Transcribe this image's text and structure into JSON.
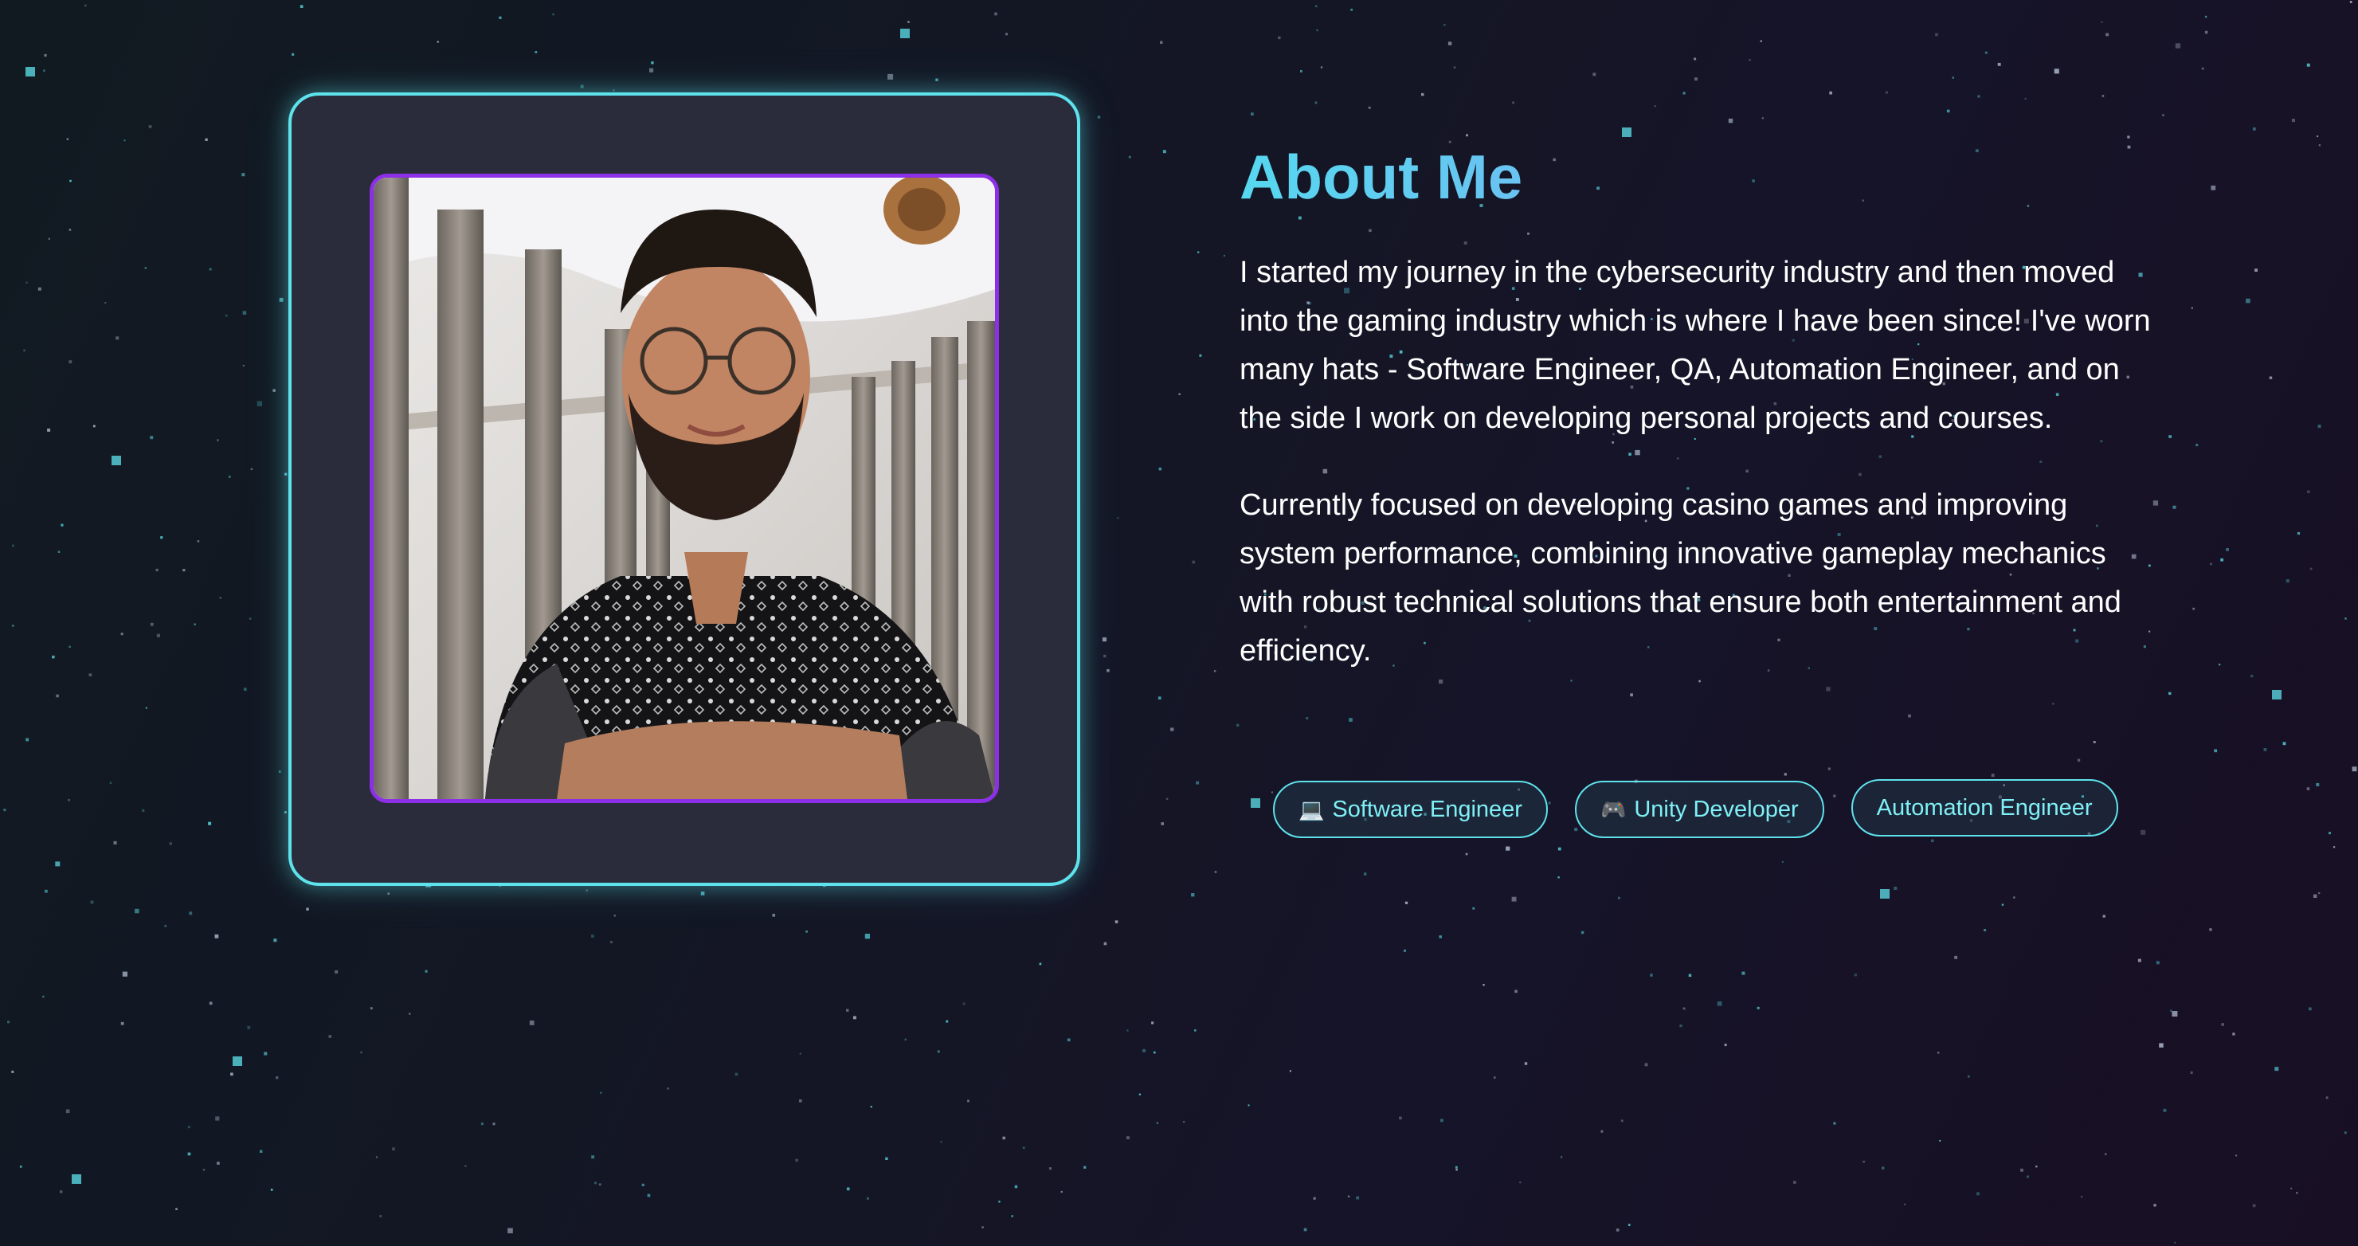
{
  "about": {
    "heading": "About Me",
    "paragraphs": [
      "I started my journey in the cybersecurity industry and then moved into the gaming industry which is where I have been since! I've worn many hats - Software Engineer, QA, Automation Engineer, and on the side I work on developing personal projects and courses.",
      "Currently focused on developing casino games and improving system performance, combining innovative gameplay mechanics with robust technical solutions that ensure both entertainment and efficiency."
    ]
  },
  "tags": [
    {
      "icon": "laptop-icon",
      "glyph": "💻",
      "label": "Software Engineer"
    },
    {
      "icon": "gamepad-icon",
      "glyph": "🎮",
      "label": "Unity Developer"
    },
    {
      "icon": "",
      "glyph": "",
      "label": "Automation Engineer"
    }
  ],
  "colors": {
    "accent_cyan": "#5ee3ec",
    "photo_border_purple": "#8d2fe6",
    "heading_gradient_start": "#56d8f0",
    "heading_gradient_end": "#8d9cf5",
    "background": "#141626"
  }
}
